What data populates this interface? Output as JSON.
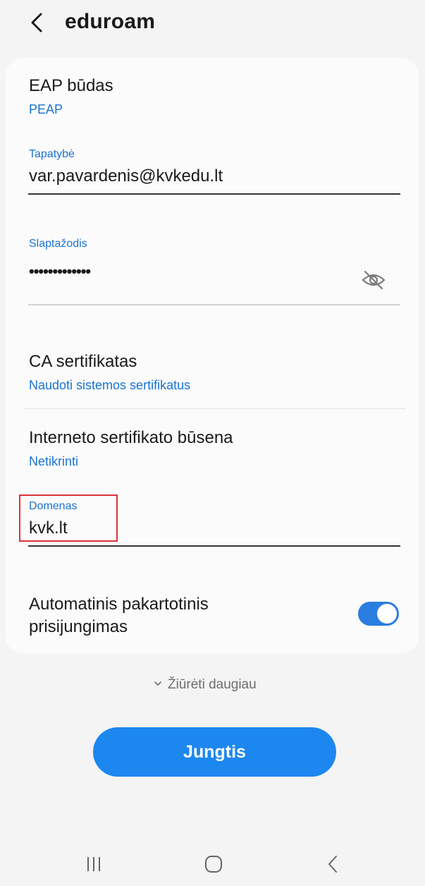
{
  "header": {
    "title": "eduroam"
  },
  "eap": {
    "label": "EAP būdas",
    "value": "PEAP"
  },
  "identity": {
    "label": "Tapatybė",
    "value": "var.pavardenis@kvkedu.lt"
  },
  "password": {
    "label": "Slaptažodis",
    "value": "•••••••••••••"
  },
  "ca_cert": {
    "label": "CA sertifikatas",
    "value": "Naudoti sistemos sertifikatus"
  },
  "online_cert": {
    "label": "Interneto sertifikato būsena",
    "value": "Netikrinti"
  },
  "domain": {
    "label": "Domenas",
    "value": "kvk.lt"
  },
  "auto_reconnect": {
    "label_line1": "Automatinis pakartotinis",
    "label_line2": "prisijungimas",
    "enabled": true
  },
  "view_more": {
    "label": "Žiūrėti daugiau"
  },
  "connect_button": {
    "label": "Jungtis"
  },
  "colors": {
    "accent": "#1a73d1",
    "button": "#1d87f0",
    "toggle": "#2a7de1",
    "highlight": "#d9343c"
  },
  "nav": {
    "recents": "recents-icon",
    "home": "home-icon",
    "back": "back-icon"
  }
}
